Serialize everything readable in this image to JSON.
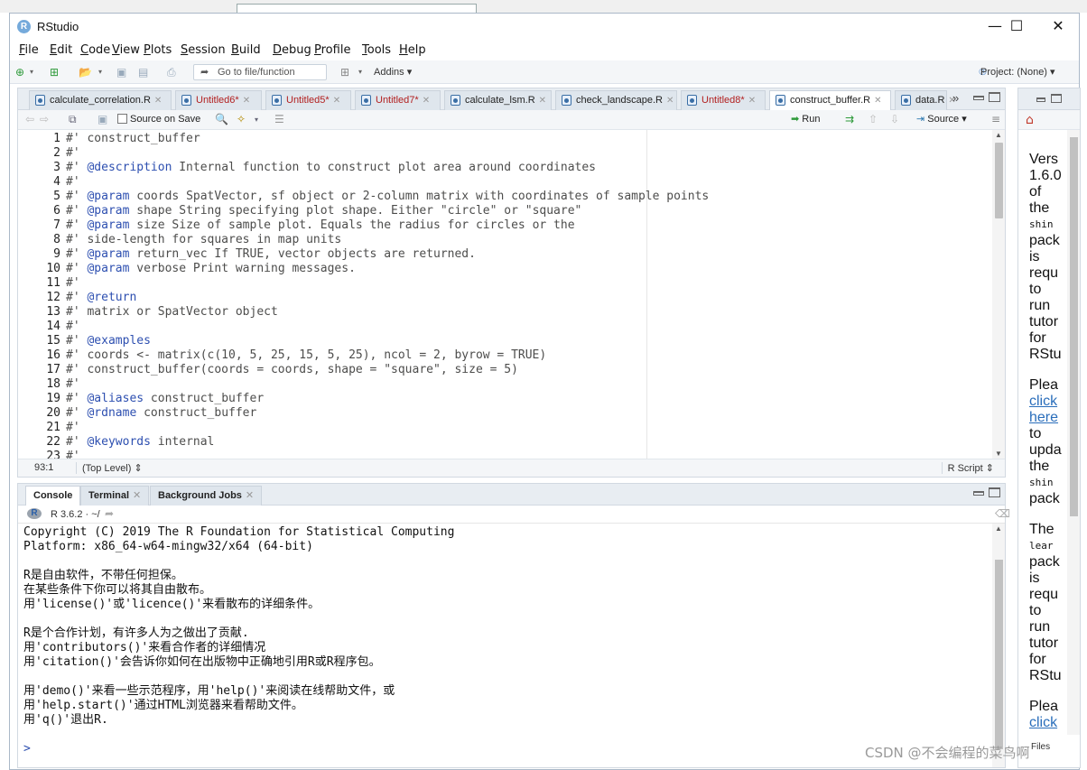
{
  "window": {
    "title": "RStudio",
    "app_icon": "R"
  },
  "menus": [
    {
      "label": "File",
      "key": "F",
      "rest": "ile"
    },
    {
      "label": "Edit",
      "key": "E",
      "rest": "dit"
    },
    {
      "label": "Code",
      "key": "C",
      "rest": "ode"
    },
    {
      "label": "View",
      "key": "V",
      "rest": "iew"
    },
    {
      "label": "Plots",
      "key": "P",
      "rest": "lots"
    },
    {
      "label": "Session",
      "key": "S",
      "rest": "ession"
    },
    {
      "label": "Build",
      "key": "B",
      "rest": "uild"
    },
    {
      "label": "Debug",
      "key": "D",
      "rest": "ebug"
    },
    {
      "label": "Profile",
      "key": "P",
      "rest": "rofile"
    },
    {
      "label": "Tools",
      "key": "T",
      "rest": "ools"
    },
    {
      "label": "Help",
      "key": "H",
      "rest": "elp"
    }
  ],
  "toolbar": {
    "goto_placeholder": "Go to file/function",
    "addins": "Addins",
    "project": "Project: (None)"
  },
  "editor": {
    "tabs": [
      {
        "label": "calculate_correlation.R",
        "unsaved": false
      },
      {
        "label": "Untitled6*",
        "unsaved": true
      },
      {
        "label": "Untitled5*",
        "unsaved": true
      },
      {
        "label": "Untitled7*",
        "unsaved": true
      },
      {
        "label": "calculate_lsm.R",
        "unsaved": false
      },
      {
        "label": "check_landscape.R",
        "unsaved": false
      },
      {
        "label": "Untitled8*",
        "unsaved": true
      },
      {
        "label": "construct_buffer.R",
        "unsaved": false,
        "active": true
      },
      {
        "label": "data.R",
        "unsaved": false
      }
    ],
    "source_on_save": "Source on Save",
    "run": "Run",
    "source": "Source",
    "status": {
      "position": "93:1",
      "scope": "(Top Level)",
      "file_type": "R Script"
    },
    "lines": [
      {
        "n": "1",
        "pre": "#' construct_buffer",
        "tag": "",
        "post": ""
      },
      {
        "n": "2",
        "pre": "#'",
        "tag": "",
        "post": ""
      },
      {
        "n": "3",
        "pre": "#' ",
        "tag": "@description",
        "post": " Internal function to construct plot area around coordinates"
      },
      {
        "n": "4",
        "pre": "#'",
        "tag": "",
        "post": ""
      },
      {
        "n": "5",
        "pre": "#' ",
        "tag": "@param",
        "post": " coords SpatVector, sf object or 2-column matrix with coordinates of sample points"
      },
      {
        "n": "6",
        "pre": "#' ",
        "tag": "@param",
        "post": " shape String specifying plot shape. Either \"circle\" or \"square\""
      },
      {
        "n": "7",
        "pre": "#' ",
        "tag": "@param",
        "post": " size Size of sample plot. Equals the radius for circles or the"
      },
      {
        "n": "8",
        "pre": "#' side-length for squares in map units",
        "tag": "",
        "post": ""
      },
      {
        "n": "9",
        "pre": "#' ",
        "tag": "@param",
        "post": " return_vec If TRUE, vector objects are returned."
      },
      {
        "n": "10",
        "pre": "#' ",
        "tag": "@param",
        "post": " verbose Print warning messages."
      },
      {
        "n": "11",
        "pre": "#'",
        "tag": "",
        "post": ""
      },
      {
        "n": "12",
        "pre": "#' ",
        "tag": "@return",
        "post": ""
      },
      {
        "n": "13",
        "pre": "#' matrix or SpatVector object",
        "tag": "",
        "post": ""
      },
      {
        "n": "14",
        "pre": "#'",
        "tag": "",
        "post": ""
      },
      {
        "n": "15",
        "pre": "#' ",
        "tag": "@examples",
        "post": ""
      },
      {
        "n": "16",
        "pre": "#' coords <- matrix(c(10, 5, 25, 15, 5, 25), ncol = 2, byrow = TRUE)",
        "tag": "",
        "post": ""
      },
      {
        "n": "17",
        "pre": "#' construct_buffer(coords = coords, shape = \"square\", size = 5)",
        "tag": "",
        "post": ""
      },
      {
        "n": "18",
        "pre": "#'",
        "tag": "",
        "post": ""
      },
      {
        "n": "19",
        "pre": "#' ",
        "tag": "@aliases",
        "post": " construct_buffer"
      },
      {
        "n": "20",
        "pre": "#' ",
        "tag": "@rdname",
        "post": " construct_buffer"
      },
      {
        "n": "21",
        "pre": "#'",
        "tag": "",
        "post": ""
      },
      {
        "n": "22",
        "pre": "#' ",
        "tag": "@keywords",
        "post": " internal"
      },
      {
        "n": "23",
        "pre": "#'",
        "tag": "",
        "post": ""
      }
    ]
  },
  "console": {
    "tabs": [
      {
        "label": "Console",
        "active": true,
        "closable": false
      },
      {
        "label": "Terminal",
        "active": false,
        "closable": true
      },
      {
        "label": "Background Jobs",
        "active": false,
        "closable": true
      }
    ],
    "version": "R 3.6.2 · ~/",
    "lines": [
      "Copyright (C) 2019 The R Foundation for Statistical Computing",
      "Platform: x86_64-w64-mingw32/x64 (64-bit)",
      "",
      "R是自由软件，不带任何担保。",
      "在某些条件下你可以将其自由散布。",
      "用'license()'或'licence()'来看散布的详细条件。",
      "",
      "R是个合作计划，有许多人为之做出了贡献.",
      "用'contributors()'来看合作者的详细情况",
      "用'citation()'会告诉你如何在出版物中正确地引用R或R程序包。",
      "",
      "用'demo()'来看一些示范程序，用'help()'来阅读在线帮助文件，或",
      "用'help.start()'通过HTML浏览器来看帮助文件。",
      "用'q()'退出R."
    ],
    "prompt": ">"
  },
  "viewer": {
    "p1": [
      "Vers",
      "1.6.0",
      "of",
      "the"
    ],
    "p1_mono": "shin",
    "p1b": [
      "pack",
      "is",
      "requ",
      "to",
      "run",
      "tutor",
      "for",
      "RStu"
    ],
    "p2a": "Plea",
    "p2_links": [
      "click",
      "here"
    ],
    "p2b": [
      "to",
      "upda",
      "the"
    ],
    "p2_mono": "shin",
    "p2c": "pack",
    "p3a": "The",
    "p3_mono": "lear",
    "p3b": [
      "pack",
      "is",
      "requ",
      "to",
      "run",
      "tutor",
      "for",
      "RStu"
    ],
    "p4a": "Plea",
    "p4_link": "click",
    "bottom": "Files"
  },
  "watermark": "CSDN @不会编程的菜鸟啊",
  "colors": {
    "tag": "#2d4fb0",
    "unsaved": "#b22020",
    "link": "#2a6ebb"
  }
}
